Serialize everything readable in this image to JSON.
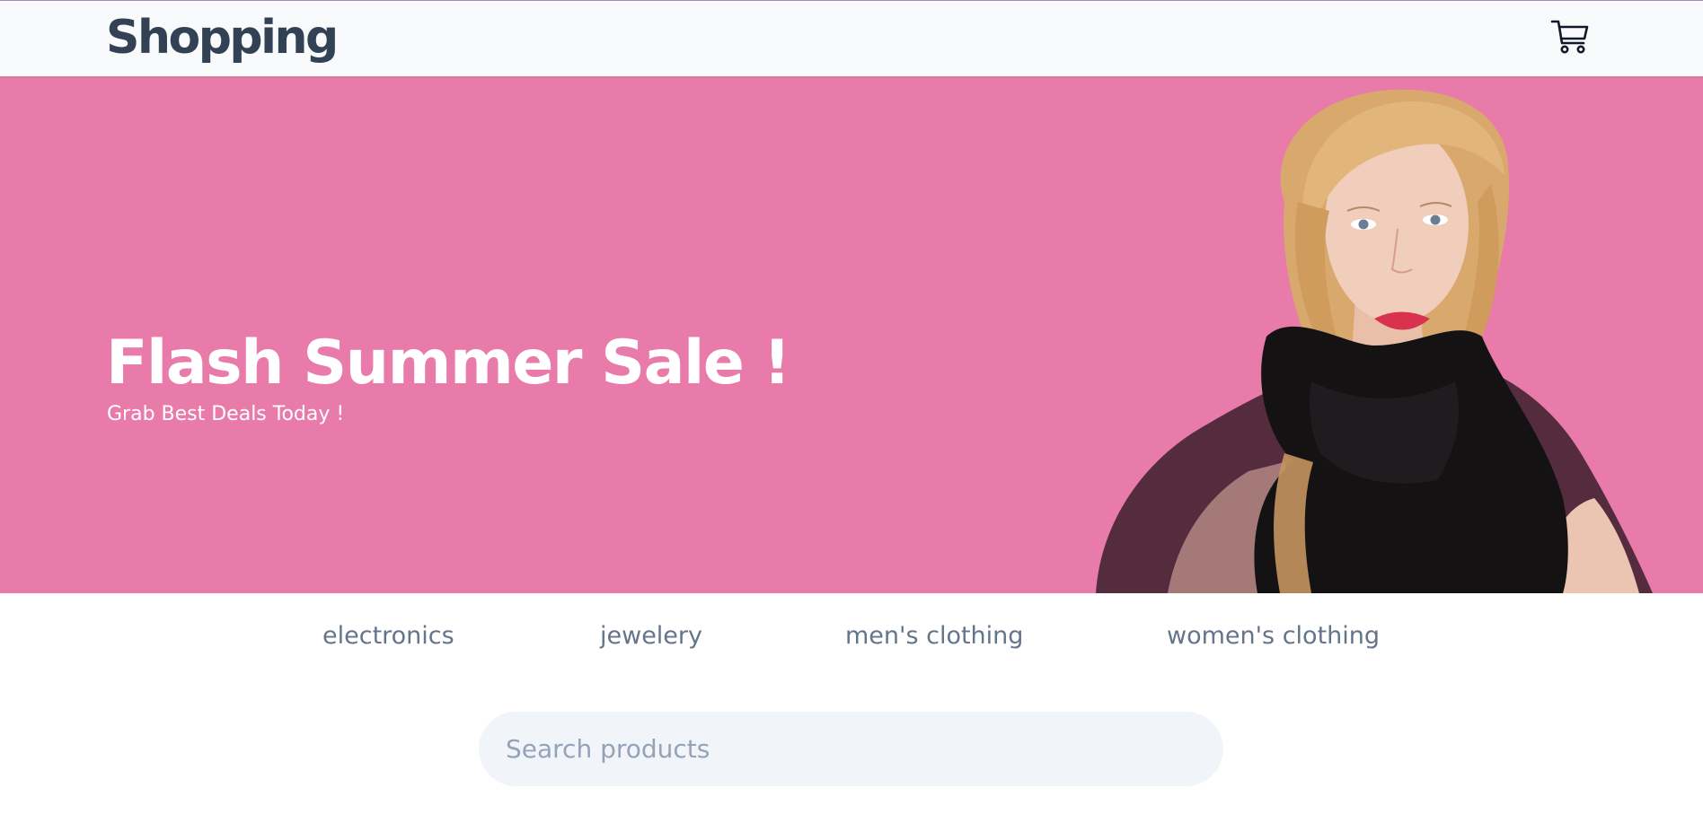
{
  "header": {
    "logo": "Shopping",
    "cart_icon": "shopping-cart-icon"
  },
  "hero": {
    "title": "Flash Summer Sale !",
    "subtitle": "Grab Best Deals Today !",
    "background_color": "#e97baa",
    "image": "woman-with-black-scarf-photo"
  },
  "categories": [
    {
      "label": "electronics"
    },
    {
      "label": "jewelery"
    },
    {
      "label": "men's clothing"
    },
    {
      "label": "women's clothing"
    }
  ],
  "search": {
    "placeholder": "Search products",
    "value": ""
  },
  "colors": {
    "logo": "#334155",
    "category_text": "#64748b",
    "search_bg": "#f1f5f9",
    "placeholder": "#94a3b8"
  }
}
